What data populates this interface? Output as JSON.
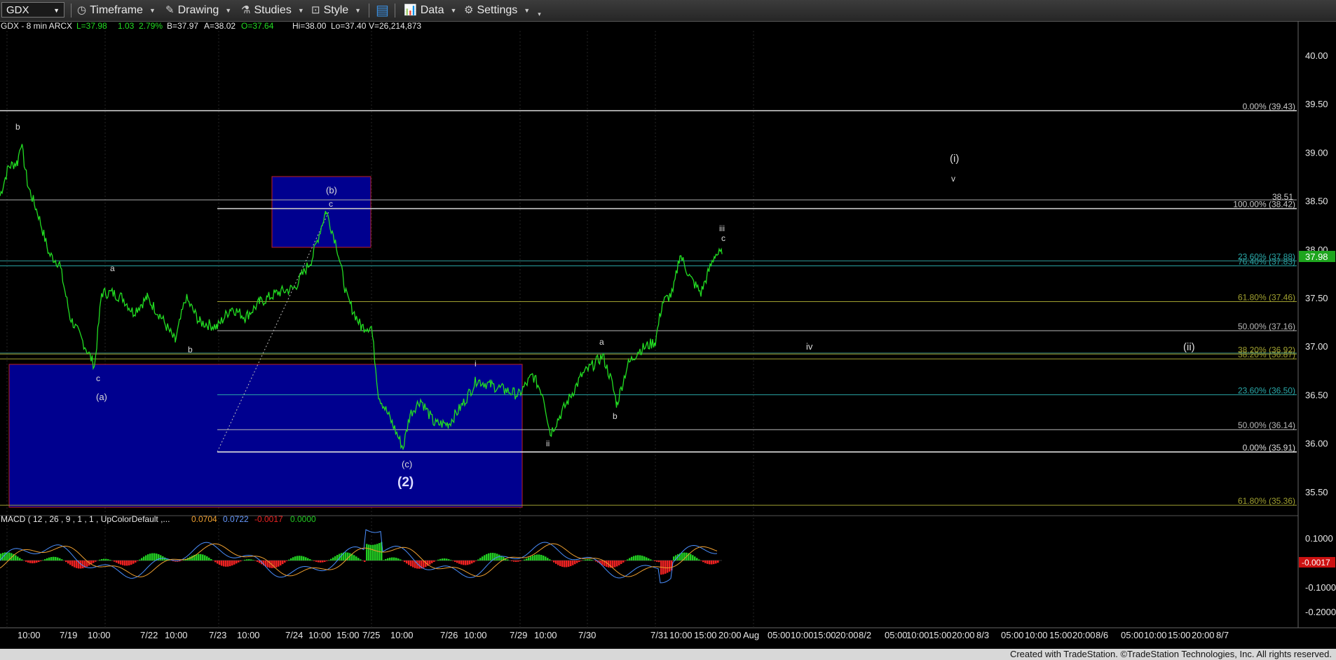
{
  "toolbar": {
    "symbol": "GDX",
    "timeframe_label": "Timeframe",
    "drawing_label": "Drawing",
    "studies_label": "Studies",
    "style_label": "Style",
    "data_label": "Data",
    "settings_label": "Settings"
  },
  "header": {
    "title": "GDX - 8 min  ARCX",
    "last": "L=37.98",
    "change": "1.03",
    "change_pct": "2.79%",
    "bid": "B=37.97",
    "ask": "A=38.02",
    "open": "O=37.64",
    "high": "Hi=38.00",
    "low": "Lo=37.40",
    "volume": "V=26,214,873"
  },
  "macd": {
    "label": "MACD ( 12 , 26 , 9 , 1 , 1 , UpColorDefault ,...",
    "v1": "0.0704",
    "v2": "0.0722",
    "v3": "-0.0017",
    "v4": "0.0000",
    "current": "-0.0017",
    "axis": [
      "0.1000",
      "0.0000",
      "-0.1000",
      "-0.2000"
    ]
  },
  "price_axis": {
    "ticks": [
      "40.00",
      "39.50",
      "39.00",
      "38.50",
      "38.00",
      "37.50",
      "37.00",
      "36.50",
      "36.00",
      "35.50"
    ],
    "current_price": "37.98",
    "marker_3851": "38.51"
  },
  "fib_levels": [
    {
      "label": "0.00% (39.43)",
      "price": 39.43,
      "color": "#c8c8c8"
    },
    {
      "label": "100.00% (38.42)",
      "price": 38.42,
      "color": "#c8c8c8"
    },
    {
      "label": "23.60% (37.88)",
      "price": 37.88,
      "color": "#2aa8a8"
    },
    {
      "label": "76.40% (37.83)",
      "price": 37.83,
      "color": "#2aa8a8"
    },
    {
      "label": "61.80% (37.46)",
      "price": 37.46,
      "color": "#a0a030"
    },
    {
      "label": "50.00% (37.16)",
      "price": 37.16,
      "color": "#b8b8b8"
    },
    {
      "label": "38.20% (36.92)",
      "price": 36.92,
      "color": "#a0a030"
    },
    {
      "label": "38.20% (36.87)",
      "price": 36.87,
      "color": "#a0a030"
    },
    {
      "label": "23.60% (36.50)",
      "price": 36.5,
      "color": "#2aa8a8"
    },
    {
      "label": "50.00% (36.14)",
      "price": 36.14,
      "color": "#b8b8b8"
    },
    {
      "label": "0.00% (35.91)",
      "price": 35.91,
      "color": "#dddddd"
    },
    {
      "label": "61.80% (35.36)",
      "price": 35.36,
      "color": "#a0a030"
    }
  ],
  "wave_labels": [
    "b",
    "c",
    "a",
    "b",
    "(a)",
    "(b)",
    "c",
    "i",
    "(c)",
    "(2)",
    "ii",
    "a",
    "b",
    "iii",
    "c",
    "iv",
    "(i)",
    "v",
    "(ii)"
  ],
  "x_axis": [
    "10:00",
    "7/19",
    "10:00",
    "7/22",
    "10:00",
    "7/23",
    "10:00",
    "7/24",
    "10:00",
    "15:00",
    "7/25",
    "10:00",
    "7/26",
    "10:00",
    "7/29",
    "10:00",
    "7/30",
    "7/31",
    "10:00",
    "15:00",
    "20:00",
    "Aug",
    "05:00",
    "10:00",
    "15:00",
    "20:00",
    "8/2",
    "05:00",
    "10:00",
    "15:00",
    "20:00",
    "8/3",
    "05:00",
    "10:00",
    "15:00",
    "20:00",
    "8/6",
    "05:00",
    "10:00",
    "15:00",
    "20:00",
    "8/7"
  ],
  "footer": "Created with TradeStation. ©TradeStation Technologies, Inc. All rights reserved.",
  "colors": {
    "price": "#22dd22",
    "macd_pos": "#22cc22",
    "macd_neg": "#ee2222",
    "box": "#00008f"
  }
}
